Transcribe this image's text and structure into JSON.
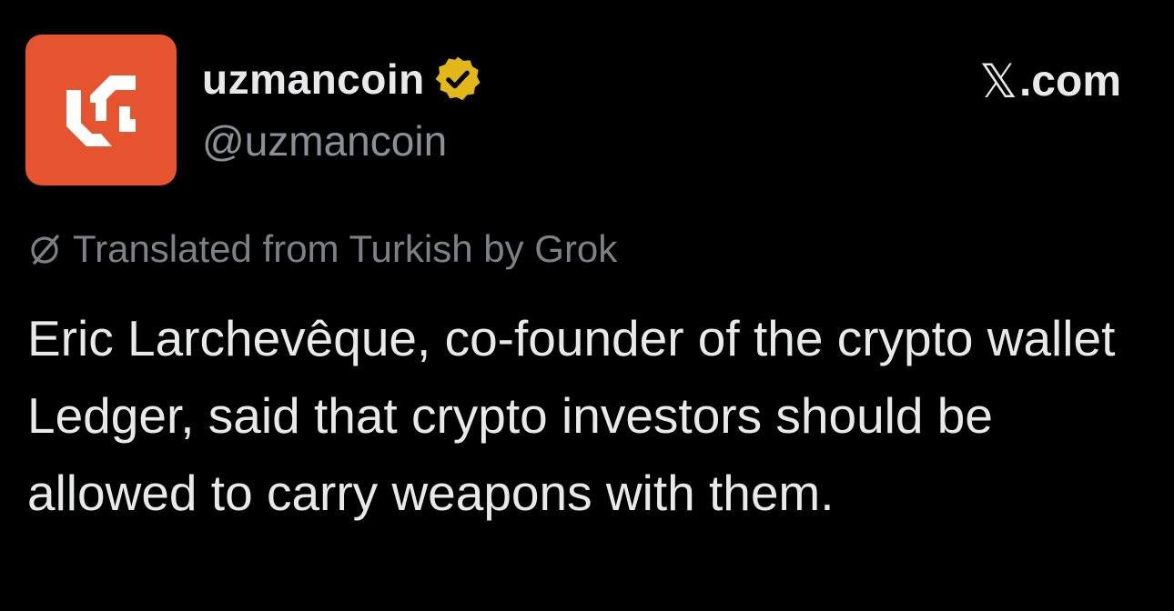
{
  "author": {
    "display_name": "uzmancoin",
    "handle": "@uzmancoin",
    "avatar_icon": "uzmancoin-logo-icon",
    "avatar_color": "#e6532f",
    "verified_icon": "verified-badge-icon",
    "verified_color": "#e2b719"
  },
  "site": {
    "brand_glyph": "𝕏",
    "domain_suffix": ".com"
  },
  "translation": {
    "icon": "grok-icon",
    "text": "Translated from Turkish by Grok"
  },
  "post": {
    "text": "Eric Larchevêque, co-founder of the crypto wallet Ledger, said that crypto investors should be allowed to carry weapons with them."
  },
  "theme": {
    "background": "#000000",
    "text_primary": "#e7e9ea",
    "text_secondary": "#8b9096"
  }
}
